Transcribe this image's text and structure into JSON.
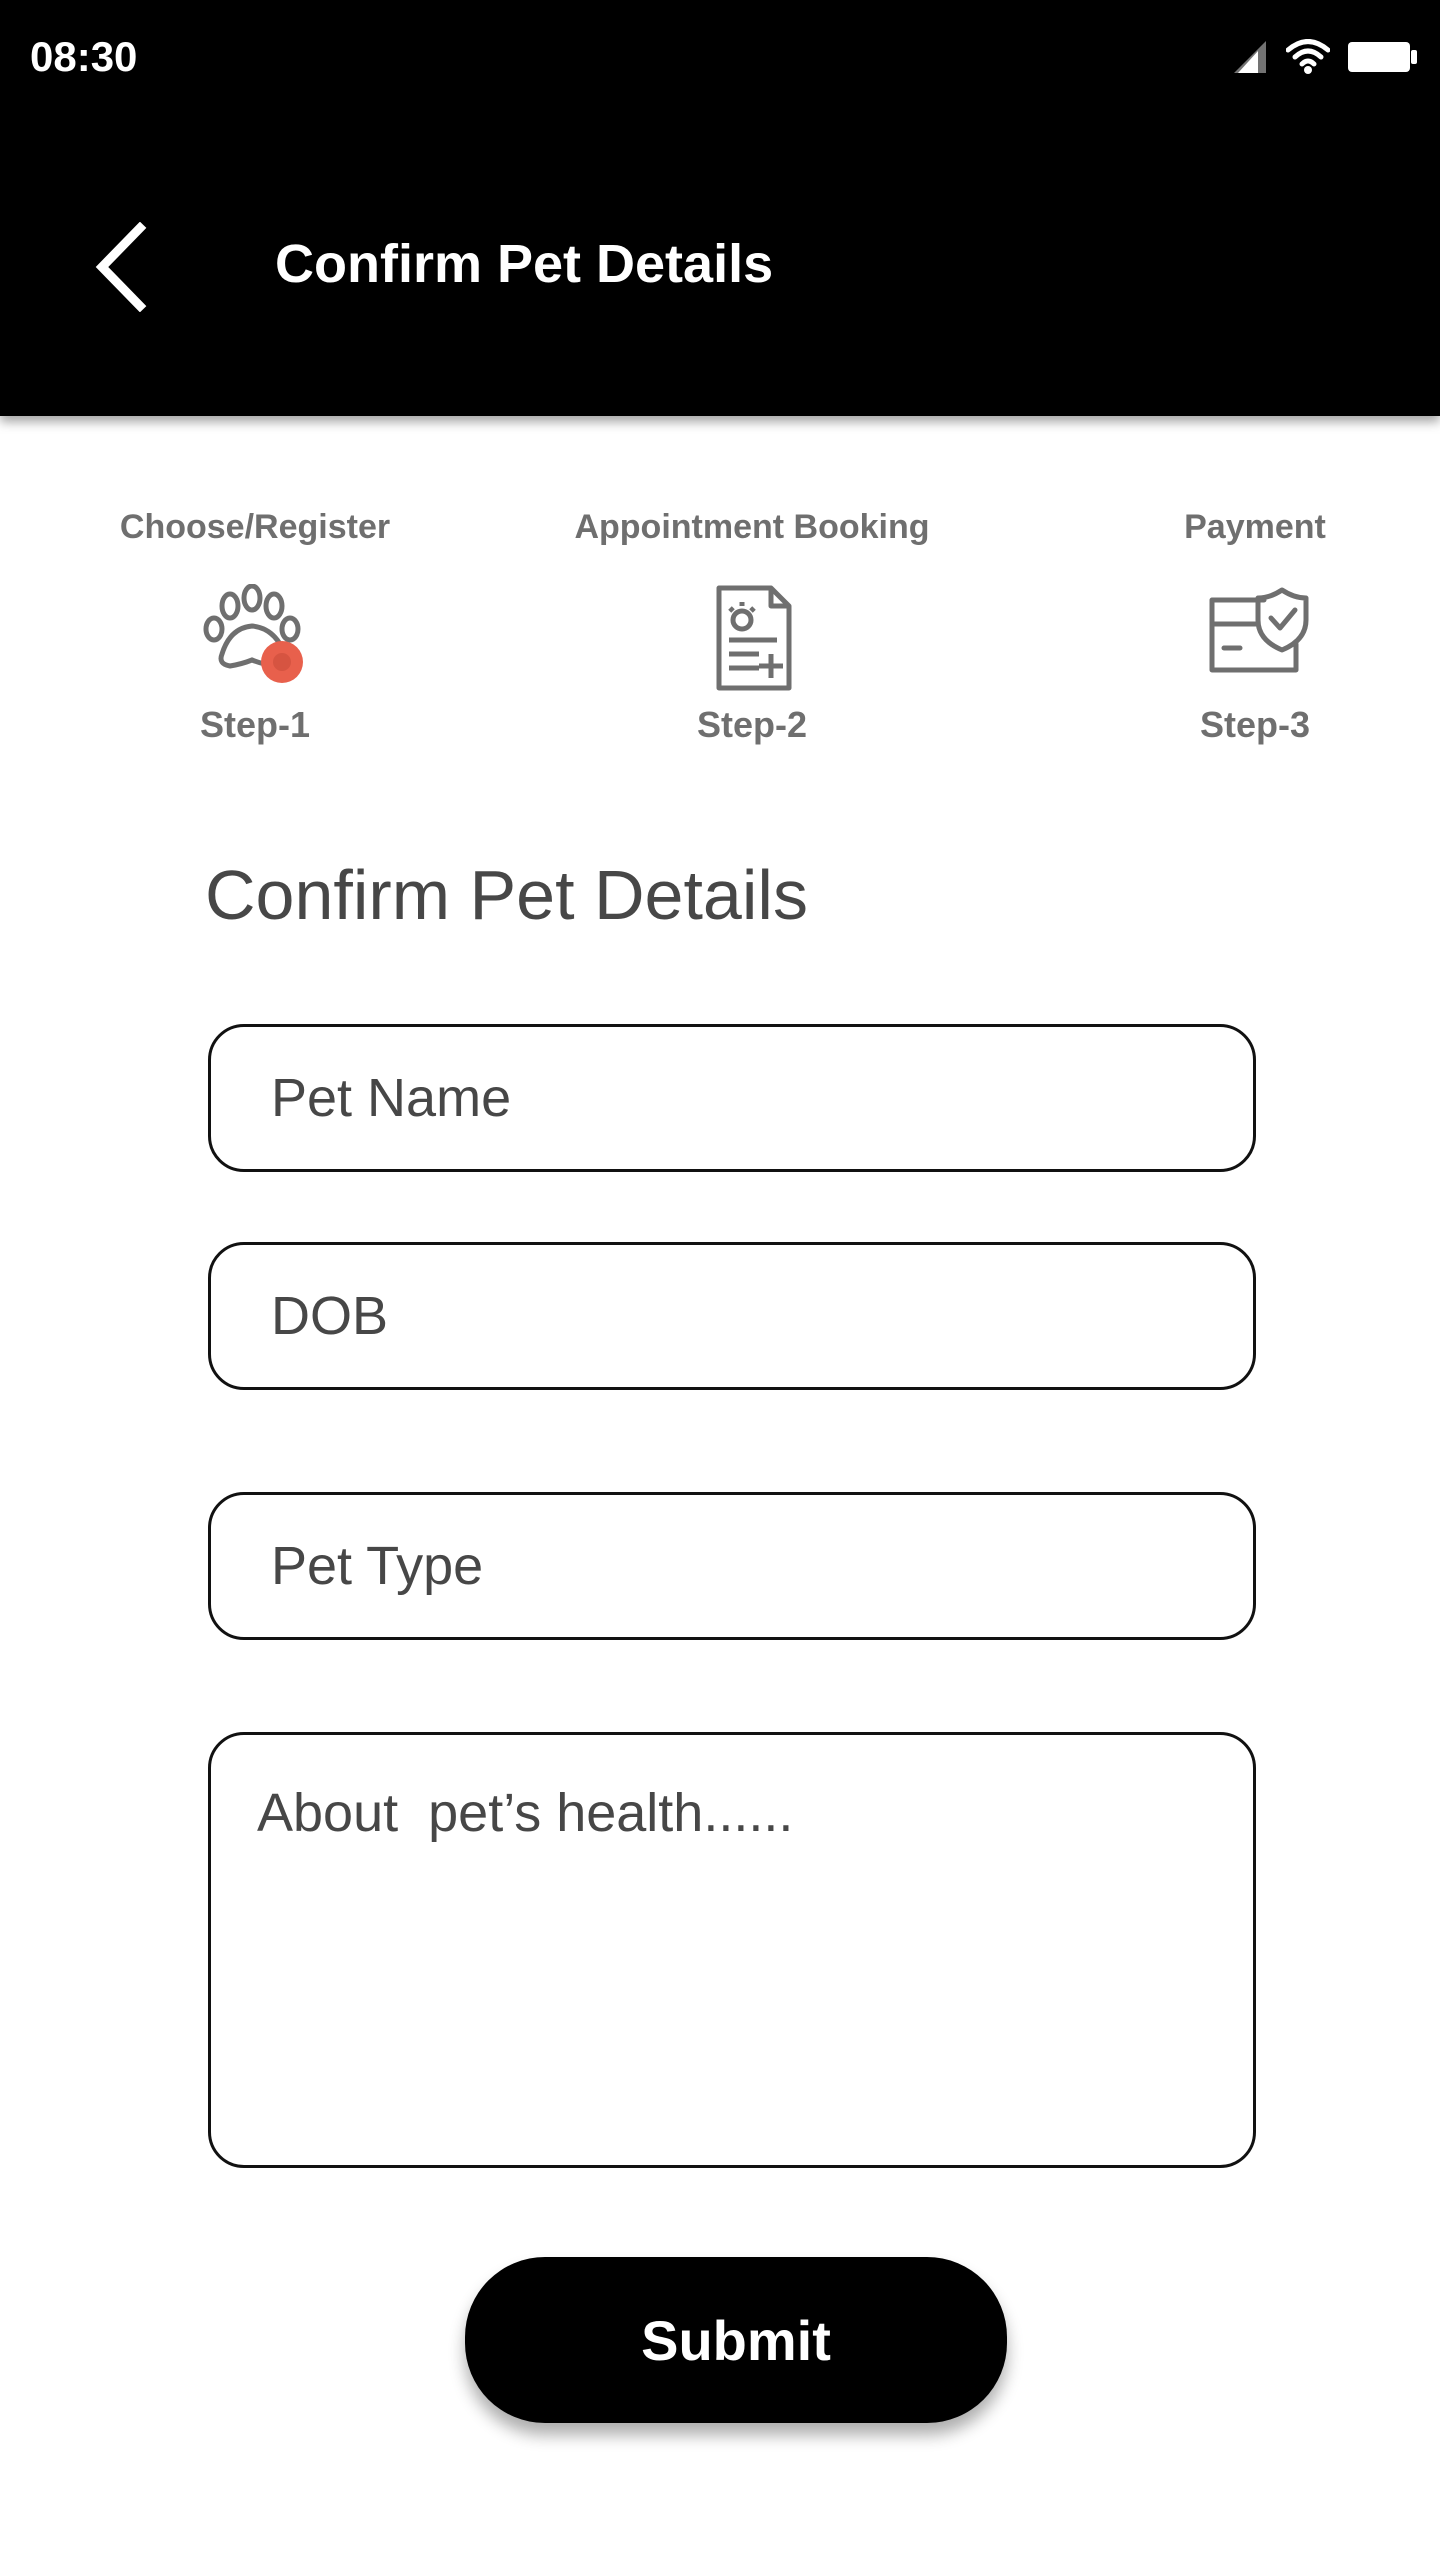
{
  "status_bar": {
    "time": "08:30",
    "icons": [
      "signal-icon",
      "wifi-icon",
      "battery-icon"
    ]
  },
  "app_bar": {
    "back_icon": "chevron-left-icon",
    "title": "Confirm Pet Details"
  },
  "stepper": {
    "steps": [
      {
        "title": "Choose/Register",
        "label": "Step-1",
        "icon": "paw-icon",
        "active": true
      },
      {
        "title": "Appointment Booking",
        "label": "Step-2",
        "icon": "document-icon",
        "active": false
      },
      {
        "title": "Payment",
        "label": "Step-3",
        "icon": "payment-shield-icon",
        "active": false
      }
    ],
    "active_color": "#e8604c",
    "inactive_color": "#6f6f6f"
  },
  "form": {
    "title": "Confirm Pet Details",
    "pet_name_placeholder": "Pet Name",
    "dob_placeholder": "DOB",
    "pet_type_placeholder": "Pet Type",
    "health_placeholder": "About  pet’s health......",
    "submit_label": "Submit"
  },
  "colors": {
    "header_background": "#000000",
    "button_background": "#000000",
    "text_primary": "#474747"
  }
}
